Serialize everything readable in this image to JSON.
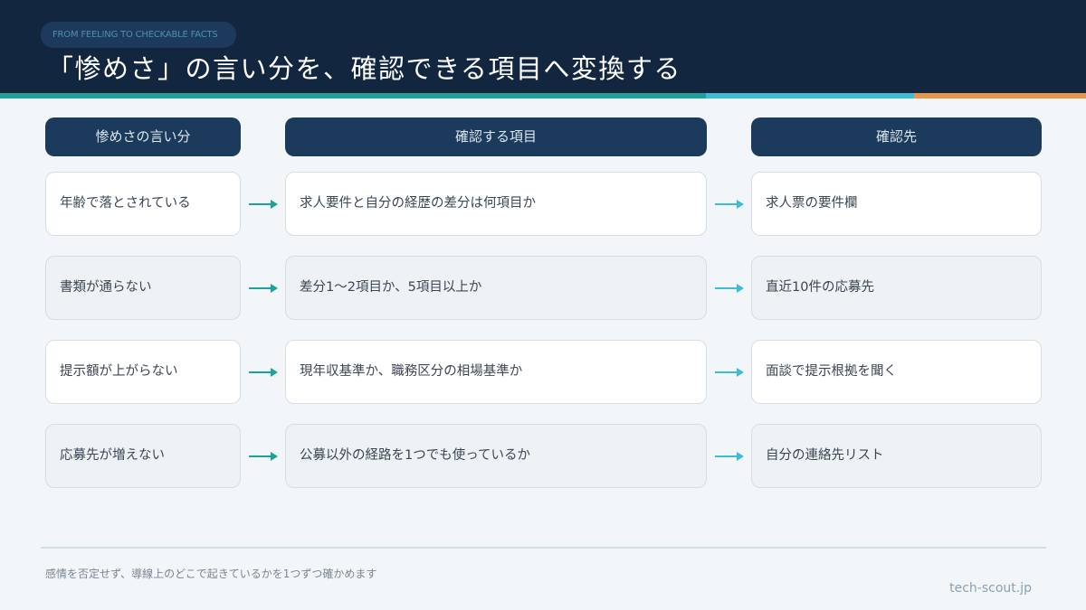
{
  "header": {
    "tag": "FROM FEELING TO CHECKABLE FACTS",
    "title": "「惨めさ」の言い分を、確認できる項目へ変換する"
  },
  "columns": {
    "complaint": "惨めさの言い分",
    "check_item": "確認する項目",
    "source": "確認先"
  },
  "rows": [
    {
      "complaint": "年齢で落とされている",
      "check_item": "求人要件と自分の経歴の差分は何項目か",
      "source": "求人票の要件欄"
    },
    {
      "complaint": "書類が通らない",
      "check_item": "差分1〜2項目か、5項目以上か",
      "source": "直近10件の応募先"
    },
    {
      "complaint": "提示額が上がらない",
      "check_item": "現年収基準か、職務区分の相場基準か",
      "source": "面談で提示根拠を聞く"
    },
    {
      "complaint": "応募先が増えない",
      "check_item": "公募以外の経路を1つでも使っているか",
      "source": "自分の連絡先リスト"
    }
  ],
  "footer": {
    "note": "感情を否定せず、導線上のどこで起きているかを1つずつ確かめます",
    "brand": "tech-scout.jp"
  },
  "colors": {
    "navy": "#132640",
    "teal": "#1fa19a",
    "cyan": "#3cbcd6",
    "orange": "#e8964a"
  }
}
